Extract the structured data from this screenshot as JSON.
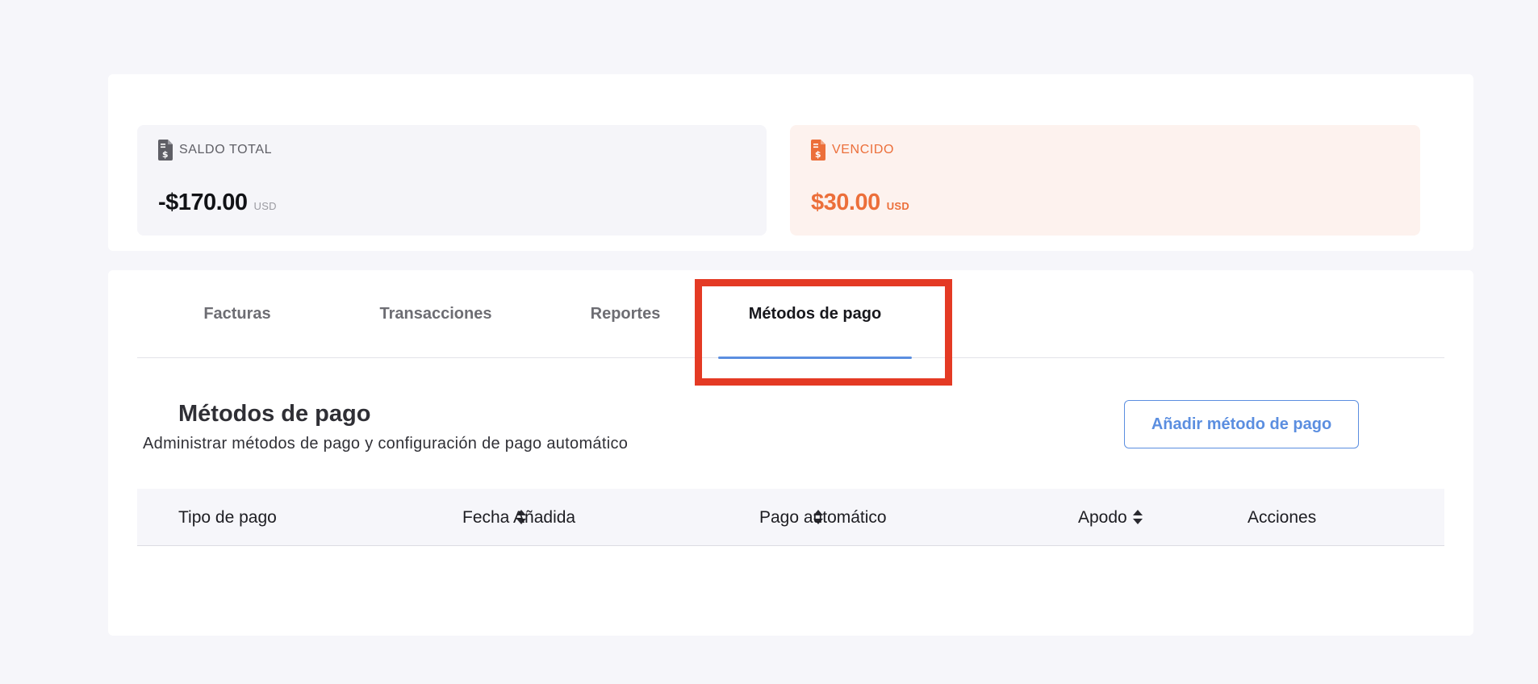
{
  "summary": {
    "total": {
      "label": "SALDO TOTAL",
      "amount": "-$170.00",
      "currency": "USD",
      "icon": "invoice-dollar-icon"
    },
    "overdue": {
      "label": "VENCIDO",
      "amount": "$30.00",
      "currency": "USD",
      "icon": "invoice-dollar-icon",
      "color": "#ec6f3a"
    }
  },
  "tabs": [
    {
      "label": "Facturas"
    },
    {
      "label": "Transacciones"
    },
    {
      "label": "Reportes"
    },
    {
      "label": "Métodos de pago",
      "active": true
    }
  ],
  "section": {
    "title": "Métodos de pago",
    "subtitle": "Administrar métodos de pago y configuración de pago automático",
    "add_button": "Añadir método de pago"
  },
  "table": {
    "columns": [
      {
        "label": "Tipo de pago",
        "sortable": true
      },
      {
        "label": "Fecha Añadida",
        "sortable": true
      },
      {
        "label": "Pago automático",
        "sortable": true
      },
      {
        "label": "Apodo",
        "sortable": false
      },
      {
        "label": "Acciones",
        "sortable": false
      }
    ],
    "rows": []
  },
  "colors": {
    "accent": "#5b8ee0",
    "overdue": "#ec6f3a",
    "highlight": "#e43a24"
  }
}
